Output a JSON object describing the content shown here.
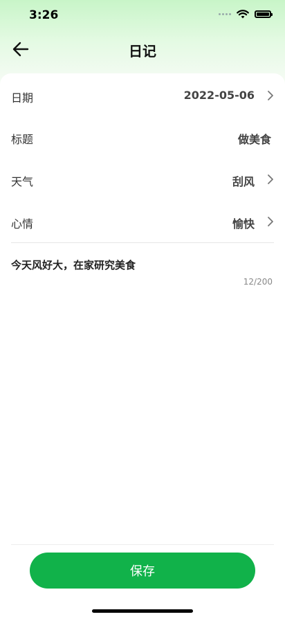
{
  "status_bar": {
    "time": "3:26"
  },
  "nav": {
    "title": "日记"
  },
  "fields": {
    "date": {
      "label": "日期",
      "value": "2022-05-06"
    },
    "title": {
      "label": "标题",
      "value": "做美食"
    },
    "weather": {
      "label": "天气",
      "value": "刮风"
    },
    "mood": {
      "label": "心情",
      "value": "愉快"
    }
  },
  "editor": {
    "content": "今天风好大，在家研究美食",
    "counter": "12/200"
  },
  "save_button": {
    "label": "保存"
  },
  "colors": {
    "accent": "#11b24a",
    "header_gradient_top": "#c8f5c8"
  },
  "icons": [
    "back-arrow-icon",
    "chevron-right-icon",
    "wifi-icon",
    "battery-icon",
    "signal-icon"
  ]
}
